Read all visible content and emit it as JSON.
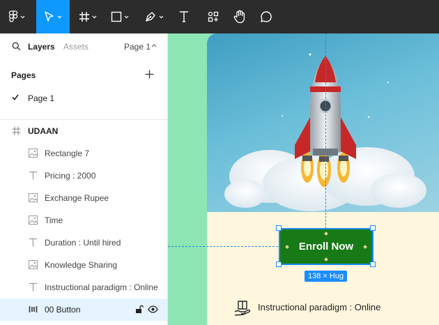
{
  "toolbar": {
    "tools": [
      {
        "name": "main-menu",
        "icon": "figma-logo-icon"
      },
      {
        "name": "move",
        "icon": "cursor-icon",
        "active": true
      },
      {
        "name": "frame",
        "icon": "frame-hash-icon"
      },
      {
        "name": "shape",
        "icon": "rectangle-icon"
      },
      {
        "name": "pen",
        "icon": "pen-icon"
      },
      {
        "name": "text",
        "icon": "text-icon"
      },
      {
        "name": "resources",
        "icon": "components-icon"
      },
      {
        "name": "hand",
        "icon": "hand-icon"
      },
      {
        "name": "comment",
        "icon": "comment-icon"
      }
    ],
    "accent": "#0d99ff"
  },
  "panel": {
    "tabs": {
      "layers": "Layers",
      "assets": "Assets",
      "page": "Page 1"
    },
    "pages_heading": "Pages",
    "pages": [
      "Page 1"
    ],
    "frame_name": "UDAAN",
    "layers": [
      {
        "label": "Rectangle 7",
        "icon": "image-icon"
      },
      {
        "label": "Pricing : 2000",
        "icon": "text-icon"
      },
      {
        "label": "Exchange Rupee",
        "icon": "image-icon"
      },
      {
        "label": "Time",
        "icon": "image-icon"
      },
      {
        "label": "Duration : Until hired",
        "icon": "text-icon"
      },
      {
        "label": "Knowledge Sharing",
        "icon": "image-icon"
      },
      {
        "label": "Instructional paradigm : Online",
        "icon": "text-icon"
      },
      {
        "label": "00 Button",
        "icon": "auto-layout-icon",
        "selected": true
      }
    ]
  },
  "canvas": {
    "button_label": "Enroll Now",
    "size_badge": "138 × Hug",
    "instruction_text": "Instructional paradigm : Online",
    "colors": {
      "canvas_bg": "#8de6b4",
      "card_bg": "#fff6de",
      "button_bg": "#177a17",
      "selection": "#1a8cff"
    }
  }
}
